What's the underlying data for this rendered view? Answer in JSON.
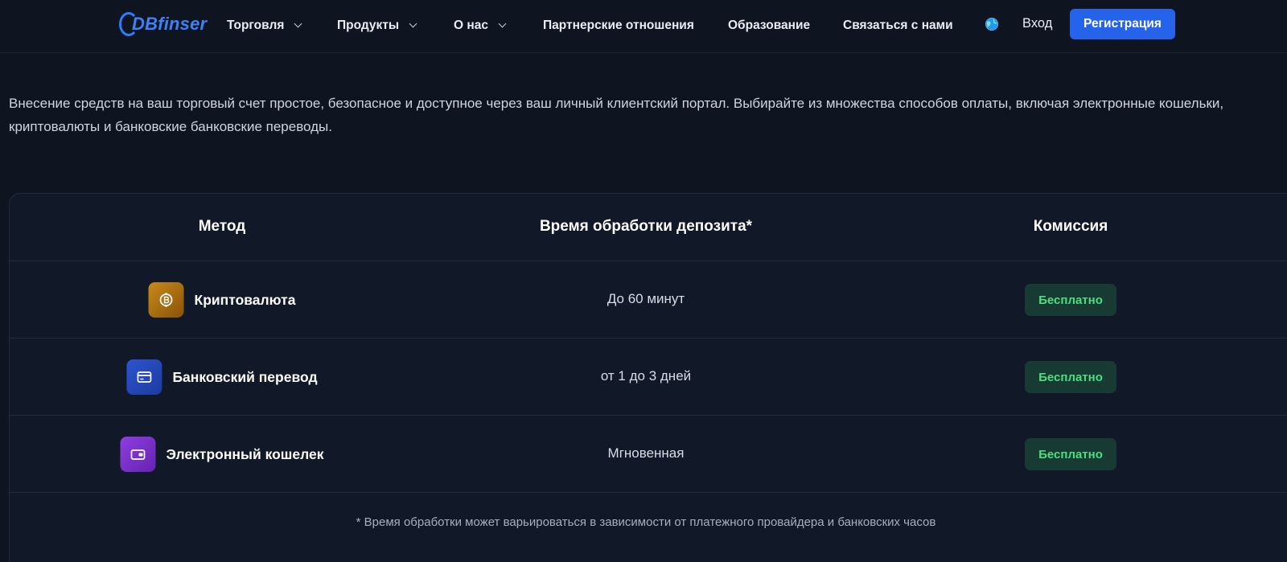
{
  "header": {
    "logo_text": "DBfinser",
    "nav": [
      {
        "label": "Торговля",
        "has_dropdown": true
      },
      {
        "label": "Продукты",
        "has_dropdown": true
      },
      {
        "label": "О нас",
        "has_dropdown": true
      },
      {
        "label": "Партнерские отношения",
        "has_dropdown": false
      },
      {
        "label": "Образование",
        "has_dropdown": false
      },
      {
        "label": "Связаться с нами",
        "has_dropdown": false
      }
    ],
    "language_icon": "globe-icon",
    "login_label": "Вход",
    "register_label": "Регистрация"
  },
  "intro_text": "Внесение средств на ваш торговый счет простое, безопасное и доступное через ваш личный клиентский портал. Выбирайте из множества способов оплаты, включая электронные кошельки, криптовалюты и банковские банковские переводы.",
  "table": {
    "headers": [
      "Метод",
      "Время обработки депозита*",
      "Комиссия"
    ],
    "rows": [
      {
        "icon": "crypto-icon",
        "icon_color": "#b8770f",
        "method": "Криптовалюта",
        "time": "До 60 минут",
        "fee": "Бесплатно"
      },
      {
        "icon": "bank-card-icon",
        "icon_color": "#2546b8",
        "method": "Банковский перевод",
        "time": "от 1 до 3 дней",
        "fee": "Бесплатно"
      },
      {
        "icon": "wallet-icon",
        "icon_color": "#7b2fc9",
        "method": "Электронный кошелек",
        "time": "Мгновенная",
        "fee": "Бесплатно"
      }
    ],
    "footnote": "* Время обработки может варьироваться в зависимости от платежного провайдера и банковских часов"
  },
  "colors": {
    "background": "#0f1421",
    "accent": "#2563eb",
    "fee_badge_bg": "#173a33",
    "fee_badge_text": "#4ade80"
  }
}
